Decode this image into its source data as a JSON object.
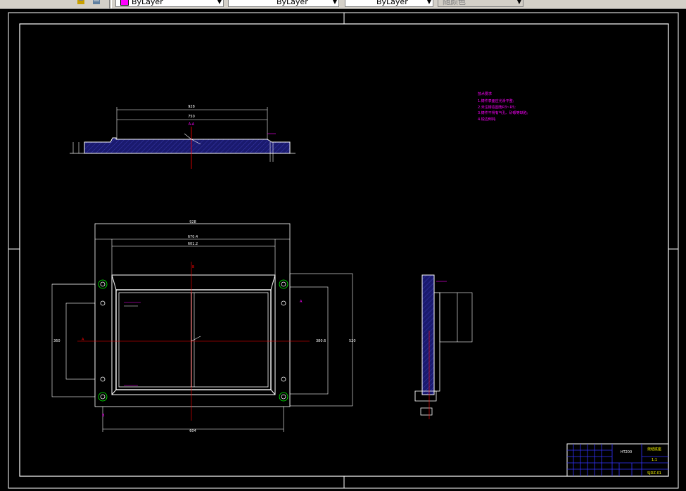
{
  "toolbar": {
    "color_control": "ByLayer",
    "linetype_control": "ByLayer",
    "lineweight_control": "ByLayer",
    "plotstyle_control": "随颜色"
  },
  "colors": {
    "background": "#000000",
    "geometry": "#ffffff",
    "centerline": "#ff0000",
    "hatch": "#1a1a6e",
    "annotation": "#ff00ff",
    "titleblock": "#3333ff",
    "titleblock_text": "#ffff00"
  },
  "drawing": {
    "section_label": "A-A",
    "notes_title": "技术要求",
    "notes": [
      "1.铸件表面应光滑平整;",
      "2.未注铸造圆角R3~R5;",
      "3.铸件不得有气孔、砂眼等缺陷;",
      "4.锐边倒钝."
    ],
    "dims_top": {
      "overall": "928",
      "mid": "750"
    },
    "dims_plan": {
      "overall": "928",
      "inner1": "670.4",
      "inner2": "601.2",
      "bottom": "604",
      "left": "360",
      "right": "520",
      "depth": "380.6"
    },
    "view_marks": {
      "a_left": "A",
      "a_right": "A",
      "b_top": "B",
      "b_bottom": "B"
    }
  },
  "title_block": {
    "part_name": "烧结底座",
    "material": "HT200",
    "scale": "1:1",
    "drawing_no": "SJDZ-01"
  }
}
